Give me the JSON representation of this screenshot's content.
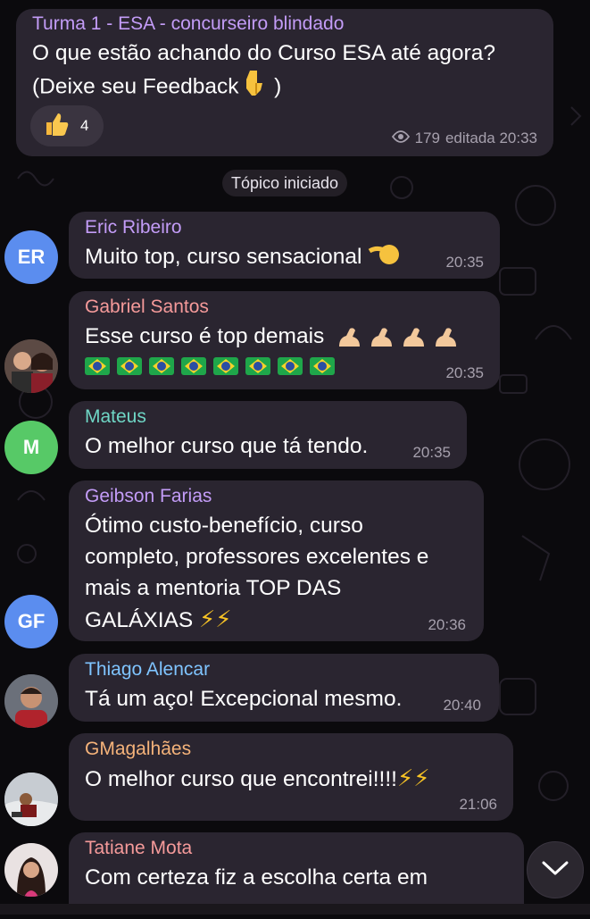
{
  "pinned": {
    "group_name": "Turma 1 - ESA - concurseiro blindado",
    "line1": "O que estão achando do Curso ESA até agora?",
    "line2": "(Deixe seu Feedback",
    "line2_end": ")",
    "reaction_count": "4",
    "views": "179",
    "edited_time": "editada 20:33"
  },
  "topic_started": "Tópico iniciado",
  "messages": [
    {
      "sender": "Eric Ribeiro",
      "color": "#c39cf7",
      "text": "Muito top, curso sensacional",
      "time": "20:35",
      "avatar_initials": "ER",
      "avatar_color": "#5b8def"
    },
    {
      "sender": "Gabriel Santos",
      "color": "#f59a9a",
      "text": "Esse curso é top demais",
      "time": "20:35"
    },
    {
      "sender": "Mateus",
      "color": "#6fd6c5",
      "text": "O melhor curso que tá tendo.",
      "time": "20:35",
      "avatar_initials": "M",
      "avatar_color": "#57c967"
    },
    {
      "sender": "Geibson Farias",
      "color": "#c39cf7",
      "line1": "Ótimo custo-benefício, curso",
      "line2": "completo, professores excelentes e",
      "line3": "mais a mentoria TOP DAS",
      "line4": "GALÁXIAS",
      "time": "20:36",
      "avatar_initials": "GF",
      "avatar_color": "#5b8def"
    },
    {
      "sender": "Thiago Alencar",
      "color": "#7fc4ff",
      "text": "Tá um aço! Excepcional mesmo.",
      "time": "20:40"
    },
    {
      "sender": "GMagalhães",
      "color": "#f5b37a",
      "text": "O melhor curso que encontrei!!!!",
      "time": "21:06"
    },
    {
      "sender": "Tatiane Mota",
      "color": "#f59a9a",
      "text": "Com certeza fiz a escolha certa em"
    }
  ]
}
